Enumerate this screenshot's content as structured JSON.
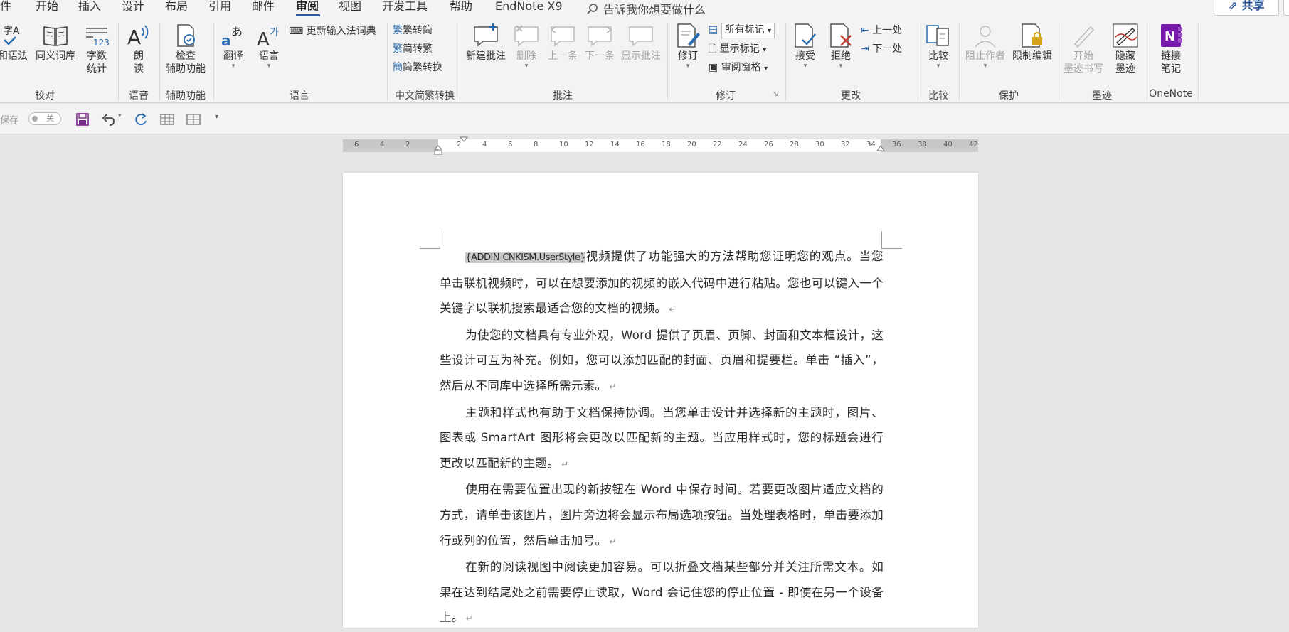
{
  "menu": {
    "items": [
      "件",
      "开始",
      "插入",
      "设计",
      "布局",
      "引用",
      "邮件",
      "审阅",
      "视图",
      "开发工具",
      "帮助",
      "EndNote X9"
    ],
    "active": "审阅",
    "tell_me": "告诉我你想要做什么",
    "share": "共享"
  },
  "ribbon": {
    "proofing": {
      "spelling": "和语法",
      "thesaurus": "同义词库",
      "wordcount": [
        "字数",
        "统计"
      ],
      "group": "校对",
      "spelling_icon": "字A",
      "wordcount_icon": "123"
    },
    "speech": {
      "read_aloud": [
        "朗",
        "读"
      ],
      "group": "语音"
    },
    "accessibility": {
      "check": [
        "检查",
        "辅助功能"
      ],
      "group": "辅助功能"
    },
    "language": {
      "translate": "翻译",
      "language": "语言",
      "update_ime": "更新输入法词典",
      "group": "语言"
    },
    "chinese_conversion": {
      "t2s": "繁转简",
      "s2t": "简转繁",
      "convert": "简繁转换",
      "group": "中文简繁转换"
    },
    "comments": {
      "new": "新建批注",
      "delete": "删除",
      "previous": "上一条",
      "next": "下一条",
      "show": "显示批注",
      "group": "批注"
    },
    "tracking": {
      "track": "修订",
      "markup_select": "所有标记",
      "show_markup": "显示标记",
      "reviewing_pane": "审阅窗格",
      "group": "修订"
    },
    "changes": {
      "accept": "接受",
      "reject": "拒绝",
      "previous": "上一处",
      "next": "下一处",
      "group": "更改"
    },
    "compare": {
      "compare": "比较",
      "group": "比较"
    },
    "protect": {
      "block_authors": "阻止作者",
      "restrict": "限制编辑",
      "group": "保护"
    },
    "ink": {
      "start_inking": [
        "开始",
        "墨迹书写"
      ],
      "hide_ink": [
        "隐藏",
        "墨迹"
      ],
      "group": "墨迹"
    },
    "onenote": {
      "linked_notes": [
        "链接",
        "笔记"
      ],
      "group": "OneNote",
      "icon_letter": "N"
    }
  },
  "qat": {
    "autosave": "保存",
    "autosave_state": "关"
  },
  "ruler": {
    "ticks": [
      "6",
      "4",
      "2",
      "",
      "2",
      "4",
      "6",
      "8",
      "10",
      "12",
      "14",
      "16",
      "18",
      "20",
      "22",
      "24",
      "26",
      "28",
      "30",
      "32",
      "34",
      "36",
      "38",
      "40",
      "42"
    ]
  },
  "document": {
    "field_code": "{ADDIN CNKISM.UserStyle}",
    "paragraphs": [
      "视频提供了功能强大的方法帮助您证明您的观点。当您单击联机视频时，可以在想要添加的视频的嵌入代码中进行粘贴。您也可以键入一个关键字以联机搜索最适合您的文档的视频。",
      "为使您的文档具有专业外观，Word 提供了页眉、页脚、封面和文本框设计，这些设计可互为补充。例如，您可以添加匹配的封面、页眉和提要栏。单击 “插入”，然后从不同库中选择所需元素。",
      "主题和样式也有助于文档保持协调。当您单击设计并选择新的主题时，图片、图表或 SmartArt 图形将会更改以匹配新的主题。当应用样式时，您的标题会进行更改以匹配新的主题。",
      "使用在需要位置出现的新按钮在 Word 中保存时间。若要更改图片适应文档的方式，请单击该图片，图片旁边将会显示布局选项按钮。当处理表格时，单击要添加行或列的位置，然后单击加号。",
      "在新的阅读视图中阅读更加容易。可以折叠文档某些部分并关注所需文本。如果在达到结尾处之前需要停止读取，Word 会记住您的停止位置 - 即使在另一个设备上。"
    ],
    "para_mark": "↵"
  },
  "colors": {
    "accent": "#2b579a",
    "onenote": "#7719aa",
    "icon_blue": "#2b6cb0"
  }
}
